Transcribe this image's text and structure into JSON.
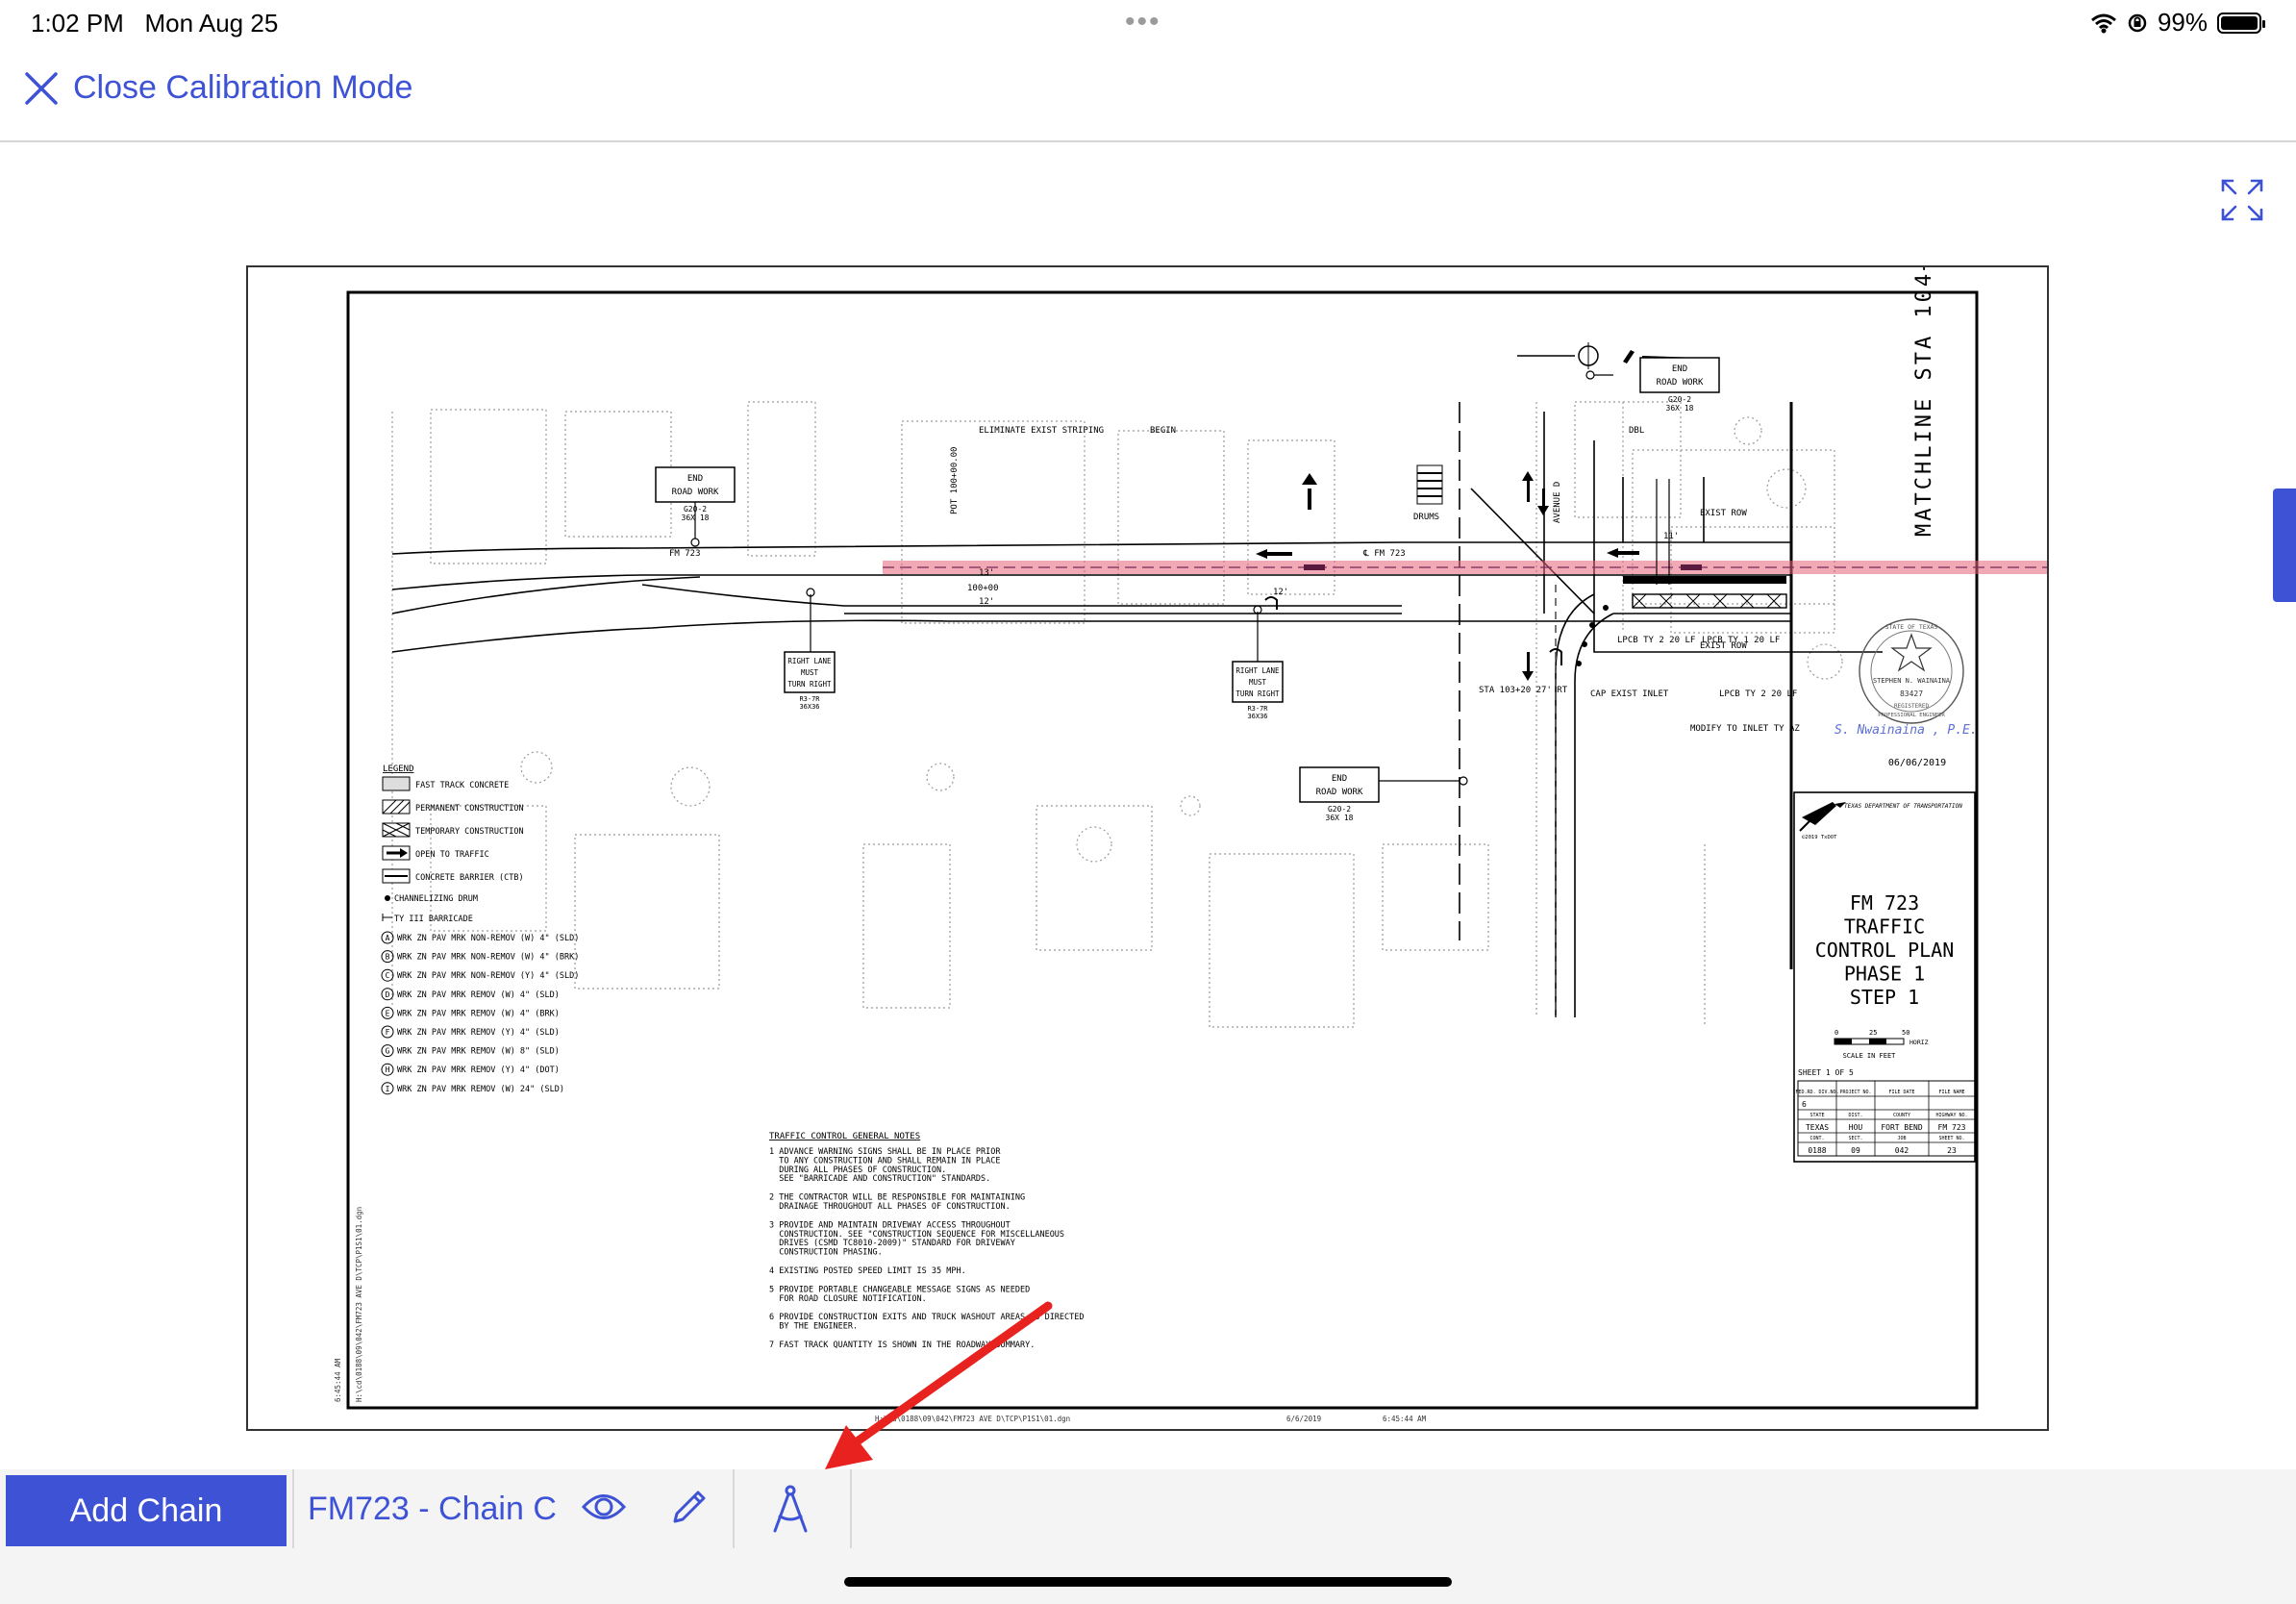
{
  "status": {
    "time": "1:02 PM",
    "date": "Mon Aug 25",
    "battery": "99%"
  },
  "nav": {
    "close_label": "Close Calibration Mode"
  },
  "plan": {
    "title_lines": [
      "FM 723",
      "TRAFFIC",
      "CONTROL PLAN",
      "PHASE 1",
      "STEP 1"
    ],
    "agency": "TEXAS DEPARTMENT OF TRANSPORTATION",
    "copyright": "©2019 TxDOT",
    "seal_date": "06/06/2019",
    "signature": "S. Nwainaina , P.E.",
    "scale_label": "SCALE IN FEET",
    "scale_ticks": [
      "0",
      "25",
      "50"
    ],
    "scale_horiz": "HORIZ",
    "sheet_label": "SHEET 1 OF 5",
    "table_headers": [
      "FED.RD. DIV.NO.",
      "PROJECT NO.",
      "FILE DATE",
      "FILE NAME"
    ],
    "table_row1": [
      "6",
      "",
      "",
      ""
    ],
    "table_headers2": [
      "STATE",
      "DIST.",
      "COUNTY",
      "HIGHWAY NO."
    ],
    "table_row2": [
      "TEXAS",
      "HOU",
      "FORT BEND",
      "FM 723"
    ],
    "table_headers3": [
      "CONT.",
      "SECT.",
      "JOB",
      "SHEET NO."
    ],
    "table_row3": [
      "0188",
      "09",
      "042",
      "23"
    ],
    "road_label": "FM 723",
    "road_label_center": "℄ FM 723",
    "eliminate": "ELIMINATE EXIST STRIPING",
    "begin": "BEGIN",
    "drums": "DRUMS",
    "avenue": "AVENUE D",
    "dbl": "DBL",
    "exist_row": "EXIST ROW",
    "matchline": "MATCHLINE STA 104+00.00",
    "pot": "POT 100+00.00",
    "sta_100": "100+00",
    "lane_13": "13'",
    "lane_12": "12'",
    "lane_11": "11'",
    "sta_103": "STA 103+20 27' RT",
    "cap_exist": "CAP EXIST INLET",
    "lpcb1": "LPCB TY 2 20 LF",
    "lpcb2": "LPCB TY 1 20 LF",
    "lpcb3": "LPCB TY 2 20 LF",
    "modify": "MODIFY TO INLET TY AZ",
    "end_road_work": [
      "END",
      "ROAD WORK"
    ],
    "g20": "G20-2",
    "g20_size": "36X 18",
    "right_lane": [
      "RIGHT LANE",
      "MUST",
      "TURN RIGHT"
    ],
    "r3_7r": "R3-7R",
    "r3_size": "36X36",
    "legend_title": "LEGEND",
    "legend_items": [
      "FAST TRACK CONCRETE",
      "PERMANENT CONSTRUCTION",
      "TEMPORARY CONSTRUCTION",
      "OPEN TO TRAFFIC",
      "CONCRETE BARRIER (CTB)",
      "CHANNELIZING DRUM",
      "TY III BARRICADE"
    ],
    "marking_items": [
      "WRK ZN PAV MRK NON-REMOV (W) 4\" (SLD)",
      "WRK ZN PAV MRK NON-REMOV (W) 4\" (BRK)",
      "WRK ZN PAV MRK NON-REMOV (Y) 4\" (SLD)",
      "WRK ZN PAV MRK REMOV (W) 4\" (SLD)",
      "WRK ZN PAV MRK REMOV (W) 4\" (BRK)",
      "WRK ZN PAV MRK REMOV (Y) 4\" (SLD)",
      "WRK ZN PAV MRK REMOV (W) 8\" (SLD)",
      "WRK ZN PAV MRK REMOV (Y) 4\" (DOT)",
      "WRK ZN PAV MRK REMOV (W) 24\" (SLD)"
    ],
    "marking_letters": [
      "A",
      "B",
      "C",
      "D",
      "E",
      "F",
      "G",
      "H",
      "I"
    ],
    "notes_title": "TRAFFIC CONTROL GENERAL NOTES",
    "notes": [
      "1 ADVANCE WARNING SIGNS SHALL BE IN PLACE PRIOR",
      "  TO ANY CONSTRUCTION AND SHALL REMAIN IN PLACE",
      "  DURING ALL PHASES OF CONSTRUCTION.",
      "  SEE \"BARRICADE AND CONSTRUCTION\" STANDARDS.",
      "2 THE CONTRACTOR WILL BE RESPONSIBLE FOR MAINTAINING",
      "  DRAINAGE THROUGHOUT ALL PHASES OF CONSTRUCTION.",
      "3 PROVIDE AND MAINTAIN DRIVEWAY ACCESS THROUGHOUT",
      "  CONSTRUCTION. SEE \"CONSTRUCTION SEQUENCE FOR MISCELLANEOUS",
      "  DRIVES (CSMD TC8010-2009)\" STANDARD FOR DRIVEWAY",
      "  CONSTRUCTION PHASING.",
      "4 EXISTING POSTED SPEED LIMIT IS 35 MPH.",
      "5 PROVIDE PORTABLE CHANGEABLE MESSAGE SIGNS AS NEEDED",
      "  FOR ROAD CLOSURE NOTIFICATION.",
      "6 PROVIDE CONSTRUCTION EXITS AND TRUCK WASHOUT AREAS AS DIRECTED",
      "  BY THE ENGINEER.",
      "7 FAST TRACK QUANTITY IS SHOWN IN THE ROADWAY SUMMARY."
    ],
    "footer_file": "H:\\cd\\0188\\09\\042\\FM723 AVE D\\TCP\\P1S1\\01.dgn",
    "footer_date": "6/6/2019",
    "footer_time": "6:45:44 AM",
    "seal_name": "STEPHEN N. WAINAINA",
    "seal_number": "83427",
    "seal_texts": [
      "STATE OF TEXAS",
      "REGISTERED",
      "PROFESSIONAL ENGINEER"
    ]
  },
  "bottom": {
    "add_chain": "Add Chain",
    "chain_name": "FM723 - Chain C"
  },
  "colors": {
    "accent": "#3d52d5",
    "calibration_line": "#e8627a",
    "annotation_arrow": "#e8231f"
  }
}
